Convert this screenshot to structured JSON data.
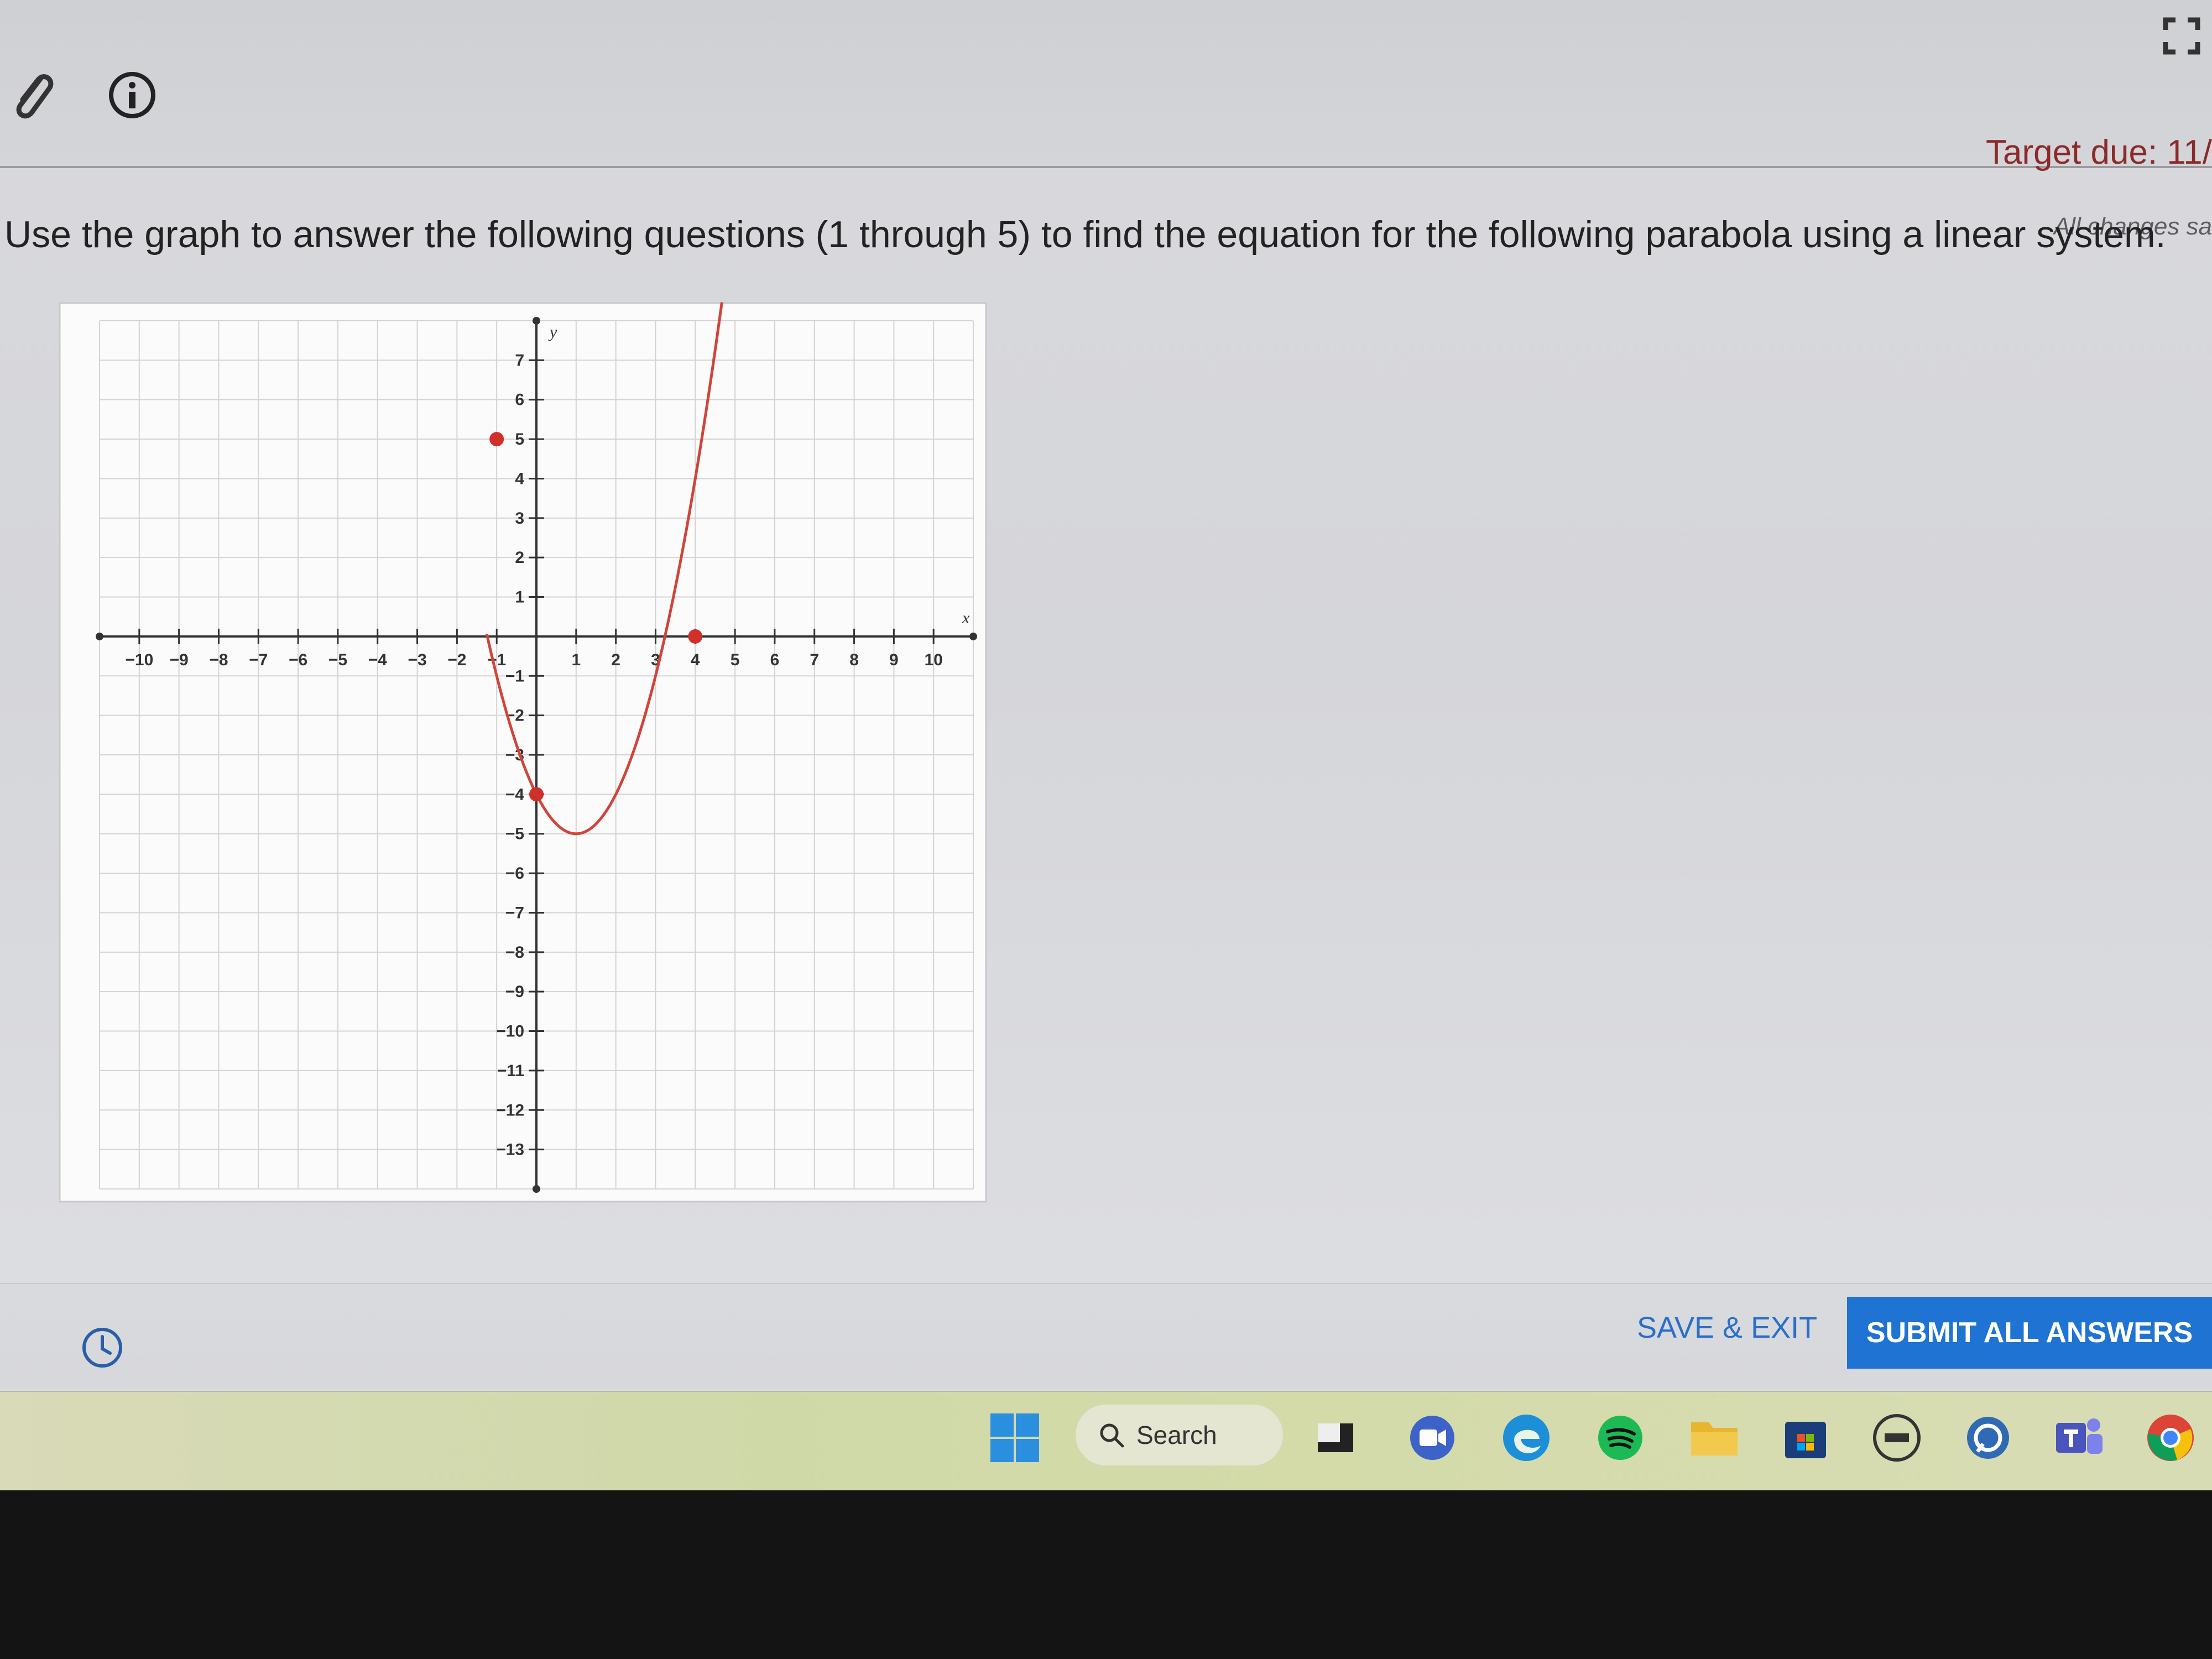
{
  "header": {
    "target_due": "Target due: 11/",
    "autosave": "All changes sa"
  },
  "question": {
    "text": "Use the graph to answer the following questions (1 through 5) to find the equation for the following parabola using a linear system."
  },
  "graph": {
    "x_axis_label": "x",
    "y_axis_label": "y",
    "x_range": [
      -10,
      10
    ],
    "y_range": [
      -13,
      7
    ],
    "x_ticks": [
      -10,
      -9,
      -8,
      -7,
      -6,
      -5,
      -4,
      -3,
      -2,
      -1,
      1,
      2,
      3,
      4,
      5,
      6,
      7,
      8,
      9,
      10
    ],
    "y_ticks": [
      7,
      6,
      5,
      4,
      3,
      2,
      1,
      -1,
      -2,
      -3,
      -4,
      -5,
      -6,
      -7,
      -8,
      -9,
      -10,
      -11,
      -12,
      -13
    ],
    "curve": {
      "type": "parabola",
      "a": 1,
      "b": -2,
      "c": -4,
      "color": "#d0453a"
    },
    "points": [
      {
        "x": -1,
        "y": 5
      },
      {
        "x": 0,
        "y": -4
      },
      {
        "x": 4,
        "y": 0
      }
    ],
    "point_color": "#d0302a"
  },
  "footer": {
    "save_exit": "SAVE & EXIT",
    "submit": "SUBMIT ALL ANSWERS"
  },
  "taskbar": {
    "search_label": "Search"
  }
}
